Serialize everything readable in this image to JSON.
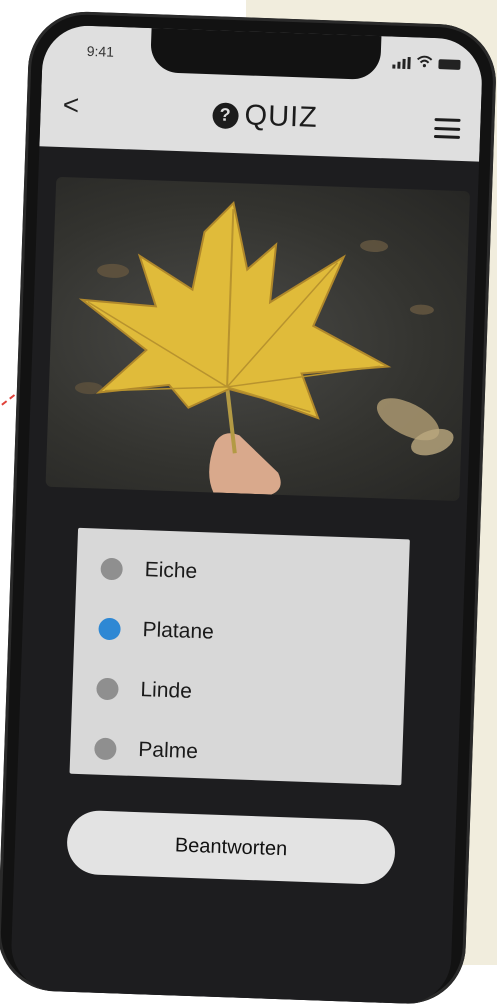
{
  "status_bar": {
    "time": "9:41"
  },
  "header": {
    "back_label": "<",
    "title": "QUIZ",
    "title_icon": "question-circle-icon"
  },
  "question_image": {
    "subject": "yellow-leaf"
  },
  "answers": [
    {
      "label": "Eiche",
      "selected": false
    },
    {
      "label": "Platane",
      "selected": true
    },
    {
      "label": "Linde",
      "selected": false
    },
    {
      "label": "Palme",
      "selected": false
    }
  ],
  "submit_label": "Beantworten",
  "colors": {
    "selected": "#2e88d4",
    "unselected": "#8f8f8f",
    "header_bg": "#dfdfdf",
    "screen_bg": "#1d1d1f"
  }
}
